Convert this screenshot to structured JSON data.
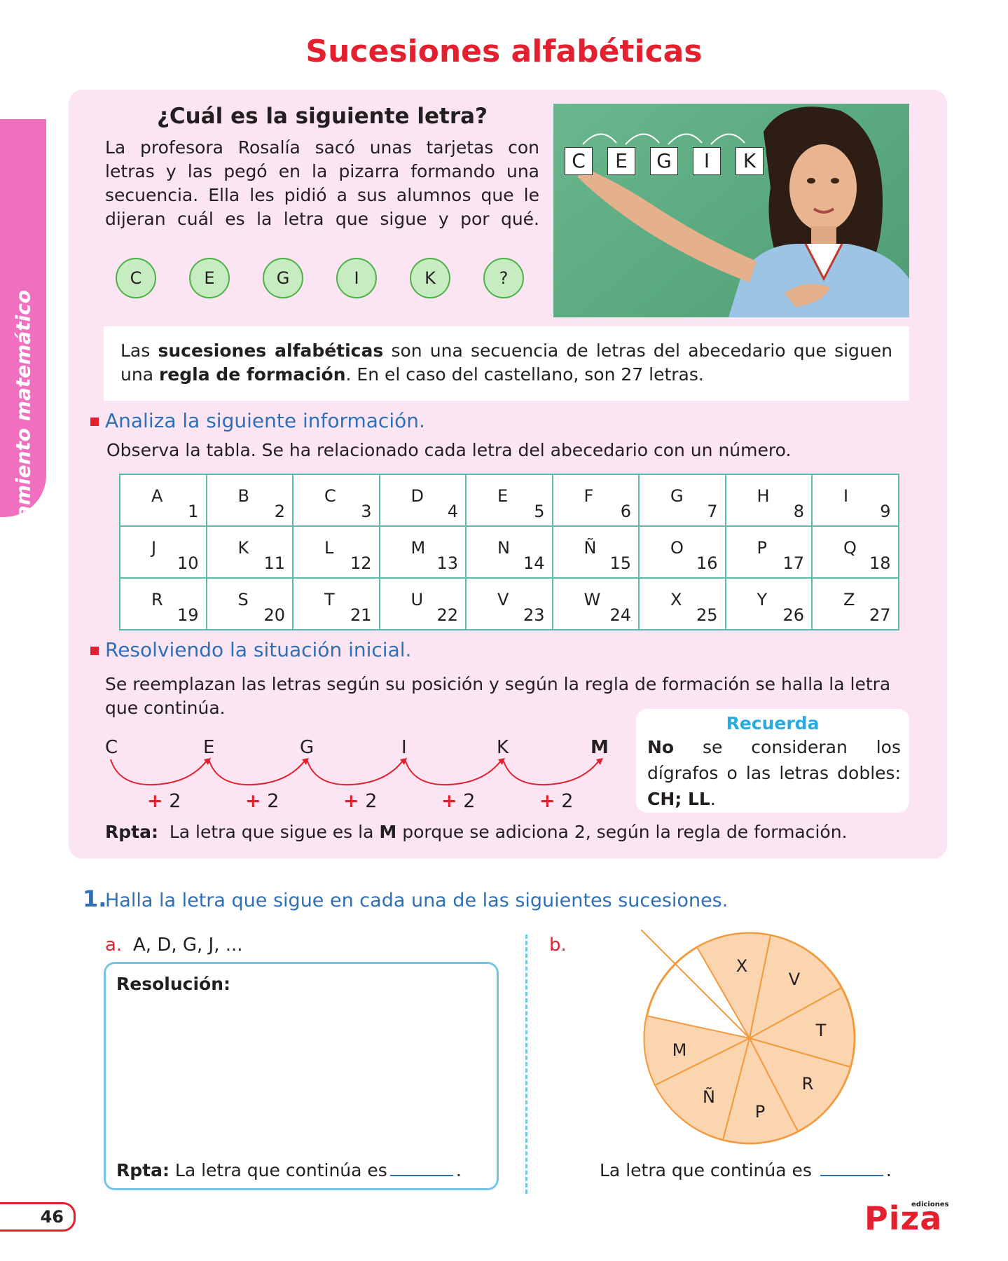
{
  "page_title": "Sucesiones alfabéticas",
  "side_tab_label": "Razonamiento matemático",
  "question_title": "¿Cuál es la siguiente letra?",
  "intro_text": "La profesora Rosalía sacó unas tarjetas con letras y las pegó en la pizarra formando una secuencia. Ella les pidió a sus alumnos que le dijeran cuál es la letra que sigue y por qué.",
  "circle_letters": [
    "C",
    "E",
    "G",
    "I",
    "K",
    "?"
  ],
  "board_cards": [
    "C",
    "E",
    "G",
    "I",
    "K"
  ],
  "definition": {
    "part1": "Las ",
    "bold1": "sucesiones alfabéticas",
    "part2": " son una secuencia de letras del abecedario que siguen una ",
    "bold2": "regla de formación",
    "part3": ". En el caso del castellano, son 27 letras."
  },
  "section1": {
    "heading": "Analiza la siguiente información.",
    "text": "Observa la tabla. Se ha relacionado cada letra del abecedario con un número."
  },
  "alphabet_table": [
    [
      [
        "A",
        "1"
      ],
      [
        "B",
        "2"
      ],
      [
        "C",
        "3"
      ],
      [
        "D",
        "4"
      ],
      [
        "E",
        "5"
      ],
      [
        "F",
        "6"
      ],
      [
        "G",
        "7"
      ],
      [
        "H",
        "8"
      ],
      [
        "I",
        "9"
      ]
    ],
    [
      [
        "J",
        "10"
      ],
      [
        "K",
        "11"
      ],
      [
        "L",
        "12"
      ],
      [
        "M",
        "13"
      ],
      [
        "N",
        "14"
      ],
      [
        "Ñ",
        "15"
      ],
      [
        "O",
        "16"
      ],
      [
        "P",
        "17"
      ],
      [
        "Q",
        "18"
      ]
    ],
    [
      [
        "R",
        "19"
      ],
      [
        "S",
        "20"
      ],
      [
        "T",
        "21"
      ],
      [
        "U",
        "22"
      ],
      [
        "V",
        "23"
      ],
      [
        "W",
        "24"
      ],
      [
        "X",
        "25"
      ],
      [
        "Y",
        "26"
      ],
      [
        "Z",
        "27"
      ]
    ]
  ],
  "section2": {
    "heading": "Resolviendo la situación inicial.",
    "text": "Se reemplazan las letras según su posición y según la regla de formación se halla la letra que continúa."
  },
  "sequence_letters": [
    "C",
    "E",
    "G",
    "I",
    "K",
    "M"
  ],
  "sequence_steps": [
    "2",
    "2",
    "2",
    "2",
    "2"
  ],
  "recuerda": {
    "title": "Recuerda",
    "bold_no": "No",
    "text": " se consideran los dígrafos o las letras dobles: ",
    "bold_digraphs": "CH; LL",
    "end": "."
  },
  "rpta": {
    "label": "Rpta:",
    "text1": "  La letra que sigue es la ",
    "bold": "M",
    "text2": " porque se adiciona 2, según la regla de formación."
  },
  "exercise": {
    "number": "1.",
    "text": "Halla la letra que sigue en cada una de las siguientes sucesiones.",
    "a_letter": "a.",
    "a_sequence": "A, D, G, J, ...",
    "b_letter": "b.",
    "resolution_label": "Resolución:",
    "a_answer_label": "Rpta:",
    "a_answer_text": " La letra que continúa es",
    "b_answer_text": "La letra que continúa es",
    "wheel_letters": [
      "X",
      "V",
      "T",
      "R",
      "P",
      "Ñ",
      "M"
    ]
  },
  "colors": {
    "title_red": "#e4202f",
    "heading_blue": "#2f6fb5",
    "panel_pink": "#fbe5f3",
    "side_tab_pink": "#f06fbf",
    "table_teal": "#5bbcad",
    "circle_green": "#c8ecc2",
    "wheel_orange": "#fbd5b0",
    "wheel_stroke": "#f39a3d"
  },
  "page_number": "46",
  "publisher": {
    "small": "ediciones",
    "name": "Piza"
  }
}
